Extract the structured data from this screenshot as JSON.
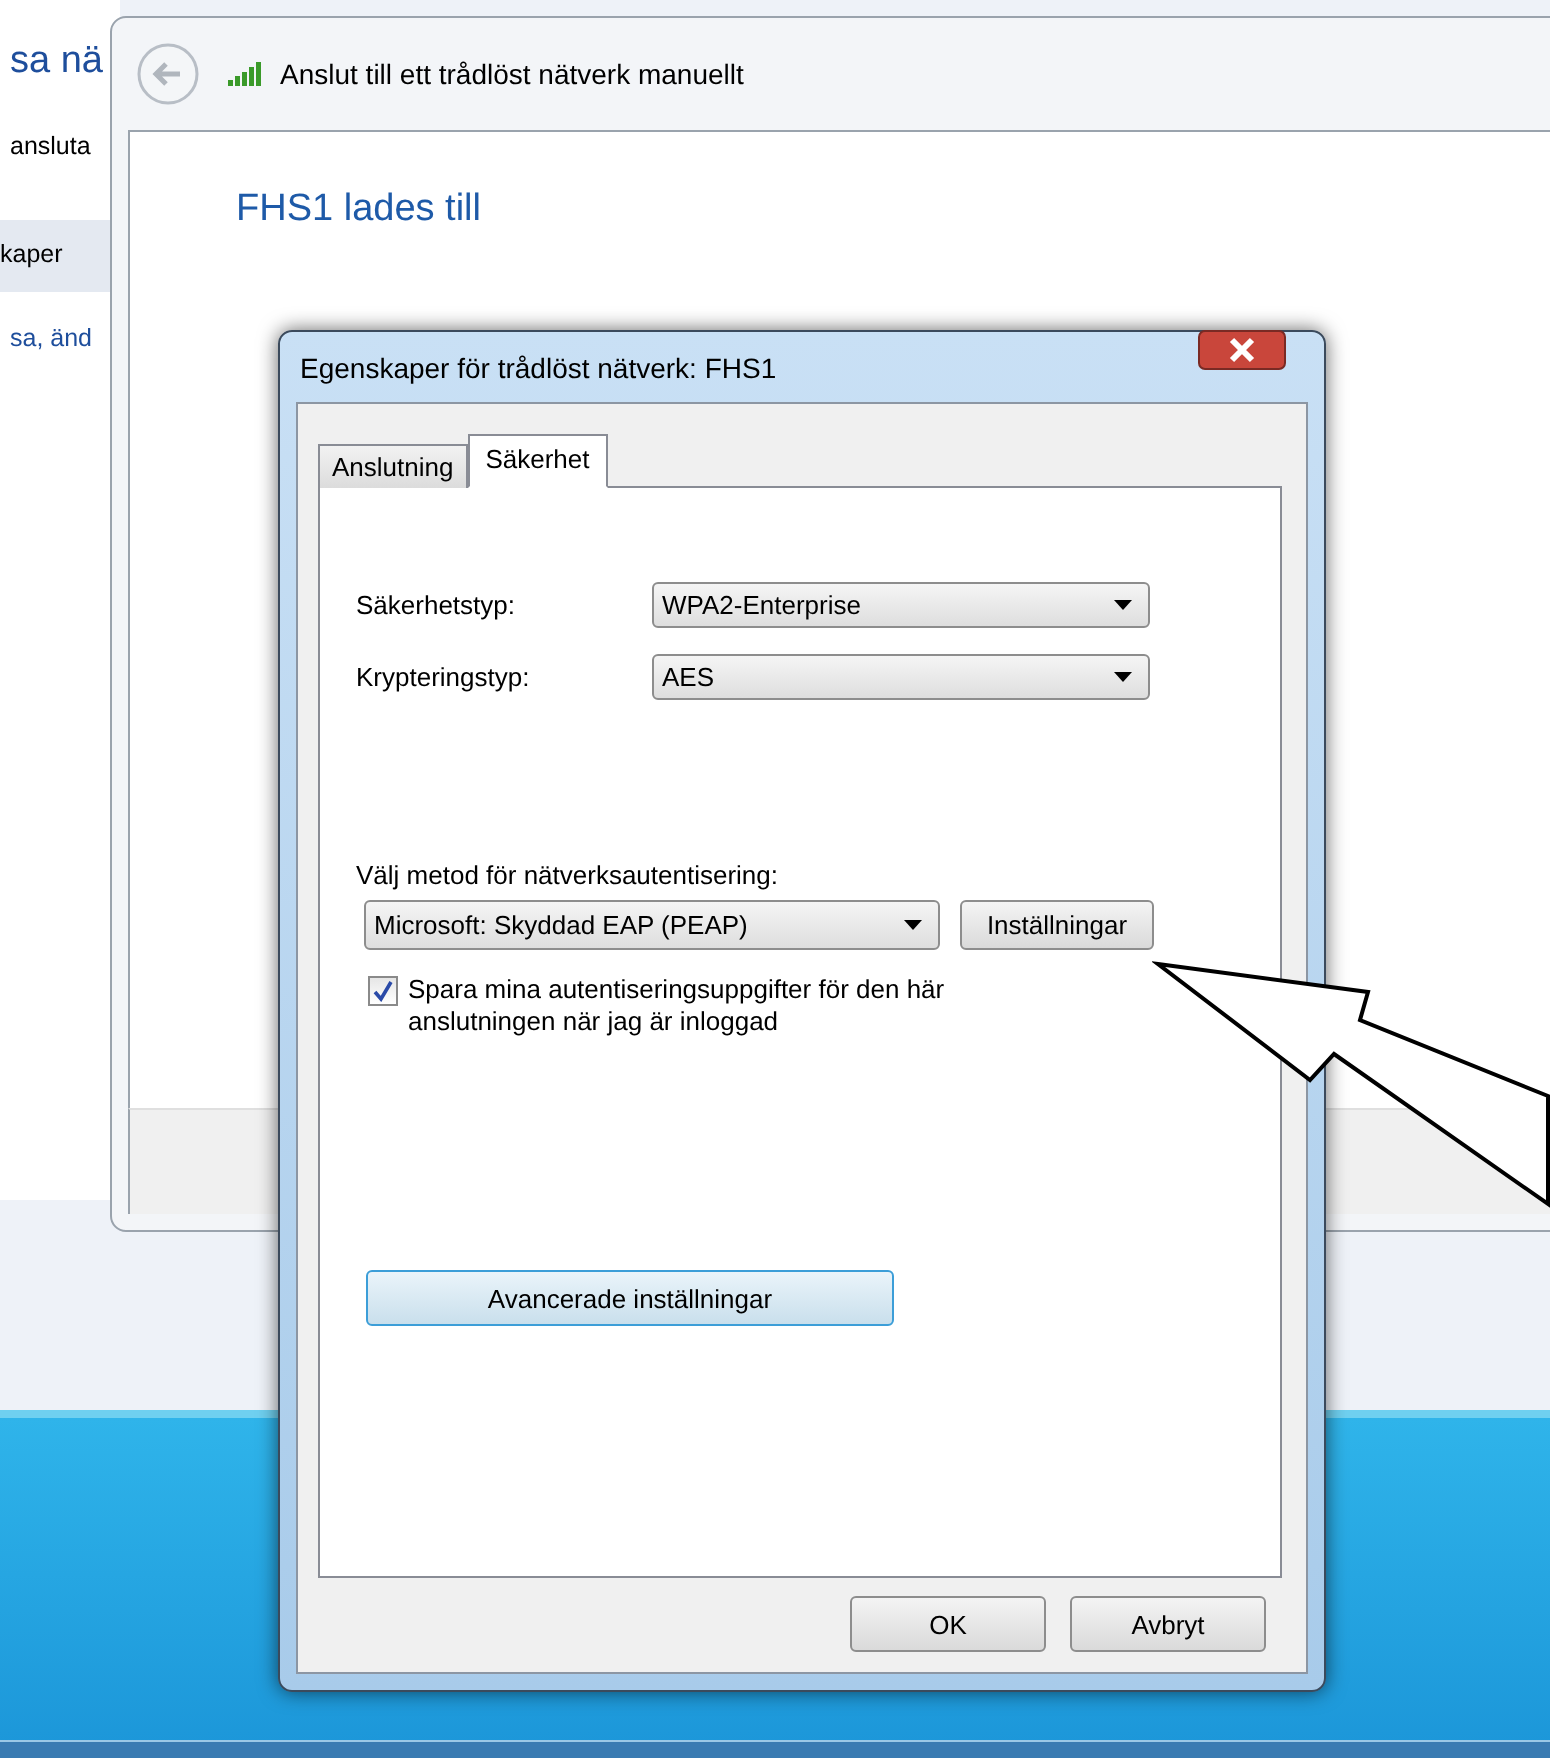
{
  "background_window": {
    "texts": [
      "sa nä",
      "ansluta",
      "kaper",
      "sa, änd"
    ]
  },
  "wizard": {
    "title": "Anslut till ett trådlöst nätverk manuellt",
    "heading": "FHS1 lades till"
  },
  "dialog": {
    "title": "Egenskaper för trådlöst nätverk: FHS1",
    "tabs": [
      {
        "label": "Anslutning",
        "selected": false
      },
      {
        "label": "Säkerhet",
        "selected": true
      }
    ],
    "fields": [
      {
        "label": "Säkerhetstyp:",
        "value": "WPA2-Enterprise"
      },
      {
        "label": "Krypteringstyp:",
        "value": "AES"
      }
    ],
    "auth": {
      "label": "Välj metod för nätverksautentisering:",
      "value": "Microsoft: Skyddad EAP (PEAP)",
      "button": "Inställningar"
    },
    "remember": {
      "label": "Spara mina autentiseringsuppgifter för den här anslutningen när jag är inloggad",
      "checked": true
    },
    "advanced_button": "Avancerade inställningar",
    "buttons": [
      "OK",
      "Avbryt"
    ]
  }
}
